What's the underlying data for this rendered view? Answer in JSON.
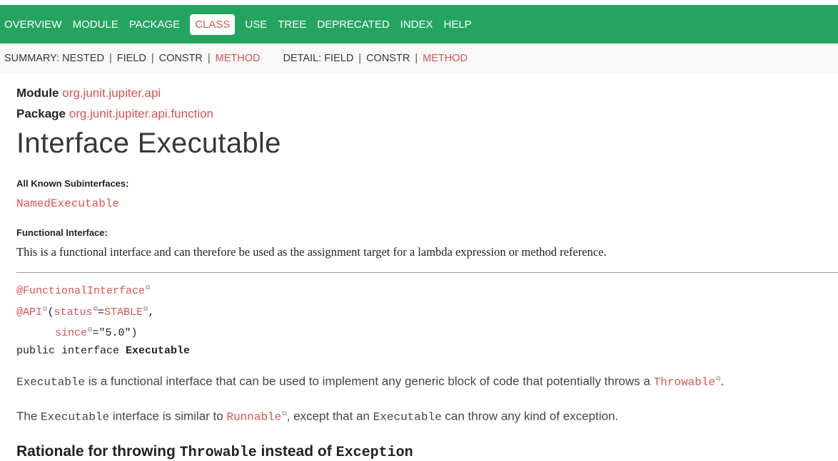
{
  "navbar": {
    "items": [
      {
        "label": "OVERVIEW"
      },
      {
        "label": "MODULE"
      },
      {
        "label": "PACKAGE"
      },
      {
        "label": "CLASS",
        "active": true
      },
      {
        "label": "USE"
      },
      {
        "label": "TREE"
      },
      {
        "label": "DEPRECATED"
      },
      {
        "label": "INDEX"
      },
      {
        "label": "HELP"
      }
    ]
  },
  "subnav": {
    "summary_prefix": "SUMMARY: NESTED",
    "summary_field": "FIELD",
    "summary_constr": "CONSTR",
    "summary_method": "METHOD",
    "detail_prefix": "DETAIL: FIELD",
    "detail_constr": "CONSTR",
    "detail_method": "METHOD",
    "separator": "|"
  },
  "header": {
    "module_label": "Module",
    "module_value": "org.junit.jupiter.api",
    "package_label": "Package",
    "package_value": "org.junit.jupiter.api.function",
    "title": "Interface Executable"
  },
  "subinterfaces": {
    "label": "All Known Subinterfaces:",
    "value": "NamedExecutable"
  },
  "functional": {
    "label": "Functional Interface:",
    "text": "This is a functional interface and can therefore be used as the assignment target for a lambda expression or method reference."
  },
  "signature": {
    "annotation1": "@FunctionalInterface",
    "annotation2": "@API",
    "open_paren": "(",
    "status_key": "status",
    "equals": "=",
    "status_value": "STABLE",
    "comma": ",",
    "indent": "      ",
    "since_key": "since",
    "since_value": "=\"5.0\")",
    "decl_prefix": "public interface ",
    "decl_name": "Executable"
  },
  "description": {
    "p1_code": "Executable",
    "p1_text": " is a functional interface that can be used to implement any generic block of code that potentially throws a ",
    "p1_link": "Throwable",
    "p1_end": ".",
    "p2_start": "The ",
    "p2_code1": "Executable",
    "p2_mid": " interface is similar to ",
    "p2_link": "Runnable",
    "p2_mid2": ", except that an ",
    "p2_code2": "Executable",
    "p2_end": " can throw any kind of exception."
  },
  "rationale": {
    "part1": "Rationale for throwing ",
    "code1": "Throwable",
    "part2": " instead of ",
    "code2": "Exception"
  },
  "icons": {
    "external_link": "external-link-icon"
  },
  "colors": {
    "nav_bg": "#25a461",
    "link": "#d9534f",
    "subnav_bg": "#f8f8f8"
  }
}
